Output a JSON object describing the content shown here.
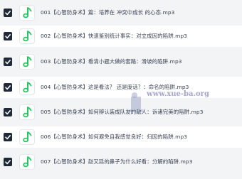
{
  "files": [
    {
      "name": "001【心智防身术】篇：培养在 冲突中成长 的心态.mp3"
    },
    {
      "name": "002【心智防身术】快速鉴别统计事实：对立成因的陷阱.mp3"
    },
    {
      "name": "003【心智防身术】看清小题大做的套路：滑坡的陷阱.mp3"
    },
    {
      "name": "004【心智防身术】这是看法？ 还是废话？：命名的陷阱.mp3"
    },
    {
      "name": "005【心智防身术】如何辨认装成队友的敌人：诉诸完美的陷阱.mp3"
    },
    {
      "name": "006【心智防身术】如何避免自我感觉良好：归因的陷阱.mp3"
    },
    {
      "name": "007【心智防身术】赵又廷的鼻子为什么好看：分解的陷阱.mp3"
    }
  ],
  "watermark": {
    "text": "www.xue-ba.org"
  },
  "icons": {
    "checkbox": "checkbox-checked-icon",
    "file": "music-note-icon"
  },
  "colors": {
    "accent": "#22c55e",
    "checkbox": "#1f2937",
    "text": "#374151"
  }
}
